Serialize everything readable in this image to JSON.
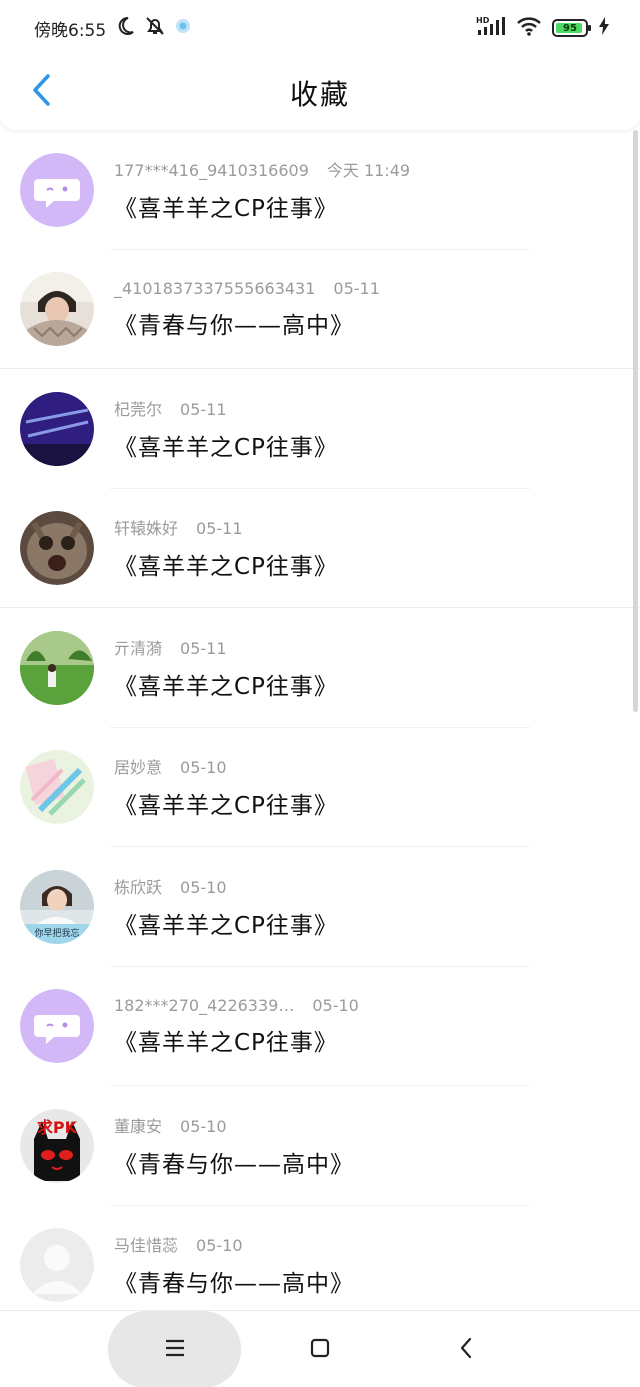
{
  "status": {
    "time": "傍晚6:55",
    "battery": "95",
    "network": "HD"
  },
  "header": {
    "title": "收藏"
  },
  "items": [
    {
      "user": "177***416_9410316609",
      "time": "今天 11:49",
      "work": "《喜羊羊之CP往事》",
      "avatar": "bubble"
    },
    {
      "user": "_4101837337555663431",
      "time": "05-11",
      "work": "《青春与你——高中》",
      "avatar": "girl-scarf"
    },
    {
      "user": "杞莞尔",
      "time": "05-11",
      "work": "《喜羊羊之CP往事》",
      "avatar": "neon-sign"
    },
    {
      "user": "轩辕姝好",
      "time": "05-11",
      "work": "《喜羊羊之CP往事》",
      "avatar": "cat"
    },
    {
      "user": "亓清漪",
      "time": "05-11",
      "work": "《喜羊羊之CP往事》",
      "avatar": "grass"
    },
    {
      "user": "居妙意",
      "time": "05-10",
      "work": "《喜羊羊之CP往事》",
      "avatar": "pens"
    },
    {
      "user": "栋欣跃",
      "time": "05-10",
      "work": "《喜羊羊之CP往事》",
      "avatar": "girl-caption",
      "caption": "你早把我忘"
    },
    {
      "user": "182***270_4226339…",
      "time": "05-10",
      "work": "《喜羊羊之CP往事》",
      "avatar": "bubble"
    },
    {
      "user": "董康安",
      "time": "05-10",
      "work": "《青春与你——高中》",
      "avatar": "black-cat",
      "caption": "求PK"
    },
    {
      "user": "马佳惜蕊",
      "time": "05-10",
      "work": "《青春与你——高中》",
      "avatar": "default"
    }
  ],
  "colors": {
    "accent": "#2e95e8",
    "avatarPurple": "#d3b8f7",
    "metaGray": "#9b9b9b"
  }
}
